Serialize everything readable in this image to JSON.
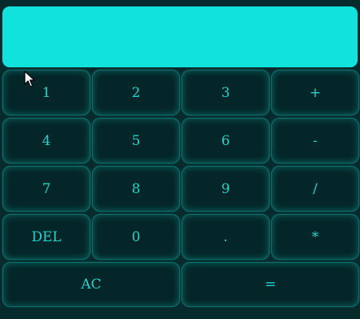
{
  "display": {
    "value": ""
  },
  "keypad": {
    "rows": [
      [
        "1",
        "2",
        "3",
        "+"
      ],
      [
        "4",
        "5",
        "6",
        "-"
      ],
      [
        "7",
        "8",
        "9",
        "/"
      ],
      [
        "DEL",
        "0",
        ".",
        "*"
      ],
      [
        "AC",
        "="
      ]
    ]
  },
  "colors": {
    "background": "#072a2c",
    "display": "#11e3dc",
    "key_text": "#1dd3cc",
    "key_border": "#0e6d6b"
  },
  "icons": {
    "cursor": "mouse-pointer-icon"
  }
}
